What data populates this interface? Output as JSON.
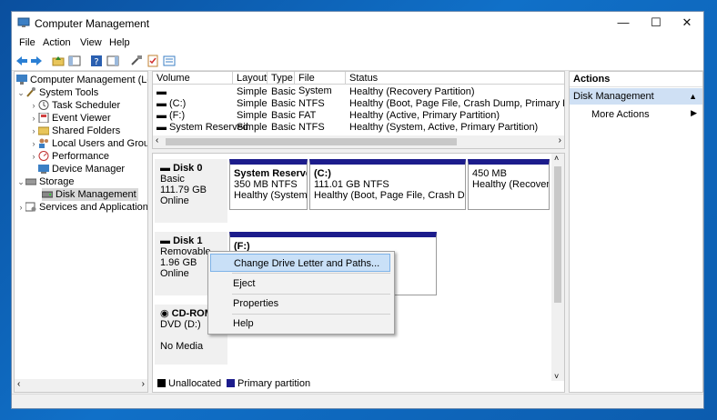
{
  "window": {
    "title": "Computer Management",
    "min_glyph": "—",
    "max_glyph": "☐",
    "close_glyph": "✕"
  },
  "menu": [
    "File",
    "Action",
    "View",
    "Help"
  ],
  "tree": {
    "root": "Computer Management (Local",
    "system_tools": "System Tools",
    "items": [
      "Task Scheduler",
      "Event Viewer",
      "Shared Folders",
      "Local Users and Groups",
      "Performance",
      "Device Manager"
    ],
    "storage": "Storage",
    "disk_management": "Disk Management",
    "services": "Services and Applications"
  },
  "volume_table": {
    "columns": [
      "Volume",
      "Layout",
      "Type",
      "File System",
      "Status"
    ],
    "rows": [
      {
        "volume": "",
        "layout": "Simple",
        "type": "Basic",
        "fs": "",
        "status": "Healthy (Recovery Partition)"
      },
      {
        "volume": "(C:)",
        "layout": "Simple",
        "type": "Basic",
        "fs": "NTFS",
        "status": "Healthy (Boot, Page File, Crash Dump, Primary Partition"
      },
      {
        "volume": "(F:)",
        "layout": "Simple",
        "type": "Basic",
        "fs": "FAT",
        "status": "Healthy (Active, Primary Partition)"
      },
      {
        "volume": "System Reserved",
        "layout": "Simple",
        "type": "Basic",
        "fs": "NTFS",
        "status": "Healthy (System, Active, Primary Partition)"
      }
    ]
  },
  "disks": {
    "disk0": {
      "name": "Disk 0",
      "kind": "Basic",
      "size": "111.79 GB",
      "state": "Online",
      "partitions": [
        {
          "name": "System Reservec",
          "size": "350 MB NTFS",
          "status": "Healthy (System, A"
        },
        {
          "name": "(C:)",
          "size": "111.01 GB NTFS",
          "status": "Healthy (Boot, Page File, Crash Dump,"
        },
        {
          "name": "",
          "size": "450 MB",
          "status": "Healthy (Recovery P"
        }
      ]
    },
    "disk1": {
      "name": "Disk 1",
      "kind": "Removable",
      "size": "1.96 GB",
      "state": "Online",
      "partition_label": "(F:)"
    },
    "cdrom": {
      "name": "CD-ROM",
      "drive": "DVD (D:)",
      "state": "No Media"
    }
  },
  "legend": {
    "unallocated": "Unallocated",
    "primary": "Primary partition",
    "unallocated_color": "#000000",
    "primary_color": "#1c1c8c"
  },
  "actions": {
    "header": "Actions",
    "selected": "Disk Management",
    "more": "More Actions"
  },
  "context_menu": [
    "Change Drive Letter and Paths...",
    "Eject",
    "Properties",
    "Help"
  ],
  "colors": {
    "accent_selection": "#cfe0f4",
    "highlight": "#c9e0f7",
    "partition_bar": "#1c1c8c"
  }
}
